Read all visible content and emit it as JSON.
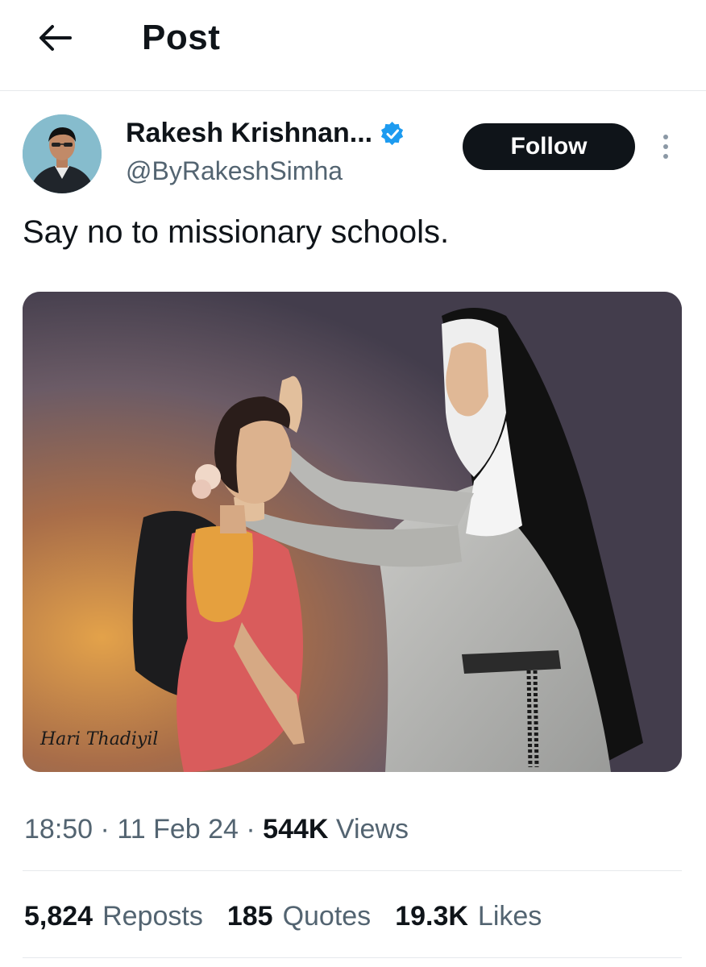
{
  "header": {
    "title": "Post",
    "back_icon": "arrow-left-icon"
  },
  "author": {
    "name": "Rakesh Krishnan...",
    "handle": "@ByRakeshSimha",
    "verified_icon": "verified-badge-icon",
    "verified_color": "#1d9bf0"
  },
  "actions": {
    "follow_label": "Follow",
    "more_icon": "more-vertical-icon"
  },
  "post": {
    "text": "Say no to missionary schools.",
    "signature": "Hari Thadiyil"
  },
  "meta": {
    "time": "18:50",
    "date": "11 Feb 24",
    "views_count": "544K",
    "views_label": "Views",
    "separator": "·"
  },
  "stats": {
    "reposts_count": "5,824",
    "reposts_label": "Reposts",
    "quotes_count": "185",
    "quotes_label": "Quotes",
    "likes_count": "19.3K",
    "likes_label": "Likes"
  }
}
